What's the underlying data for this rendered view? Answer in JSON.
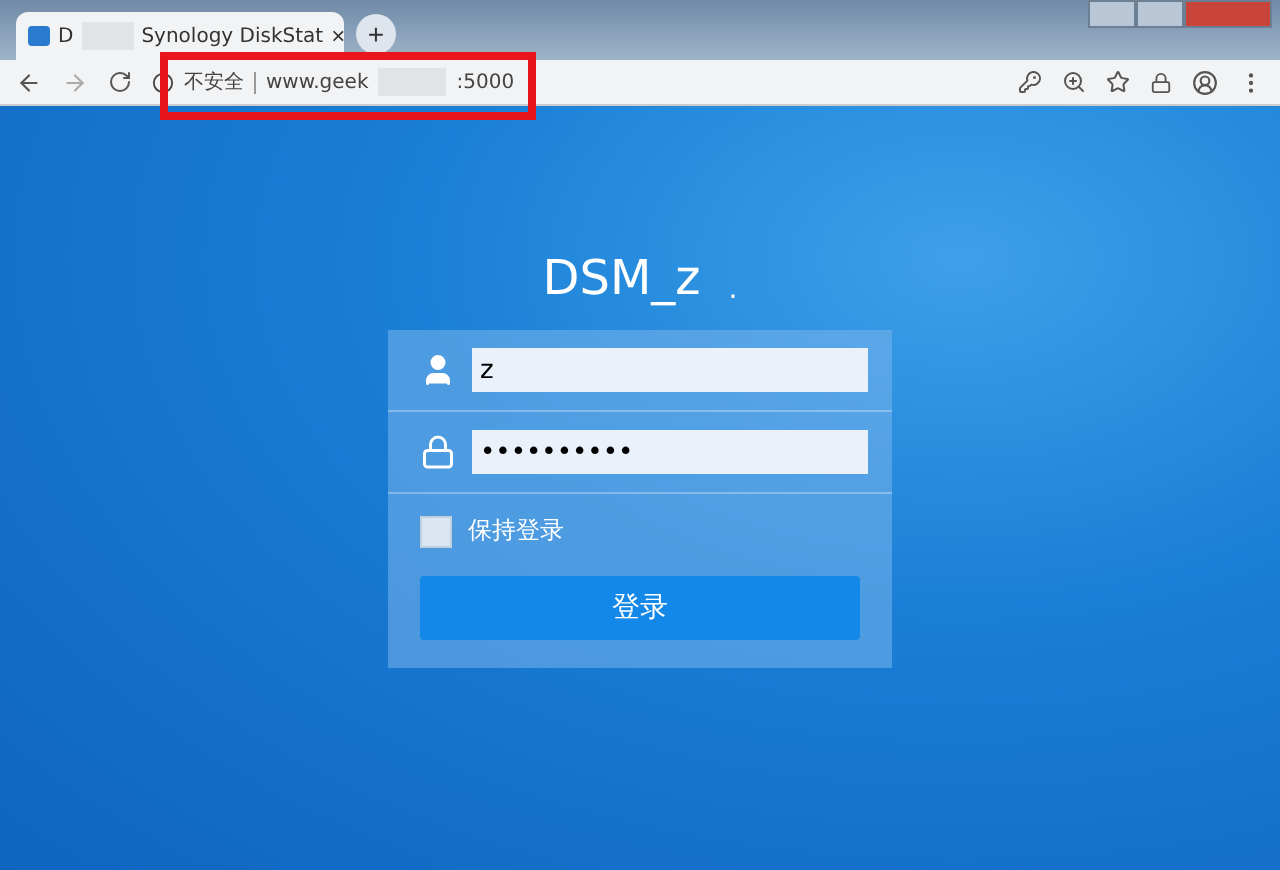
{
  "tab": {
    "title_start": "D",
    "title_end": "Synology DiskStat",
    "close": "×",
    "new_tab": "+"
  },
  "address_bar": {
    "security": "不安全",
    "url_start": "www.geek",
    "url_end": ":5000"
  },
  "login": {
    "server_name": "DSM_z",
    "server_name_end": ".",
    "username": "z",
    "password": "••••••••••",
    "remember": {
      "label": "保持登录",
      "checked": false
    },
    "submit": "登录"
  }
}
